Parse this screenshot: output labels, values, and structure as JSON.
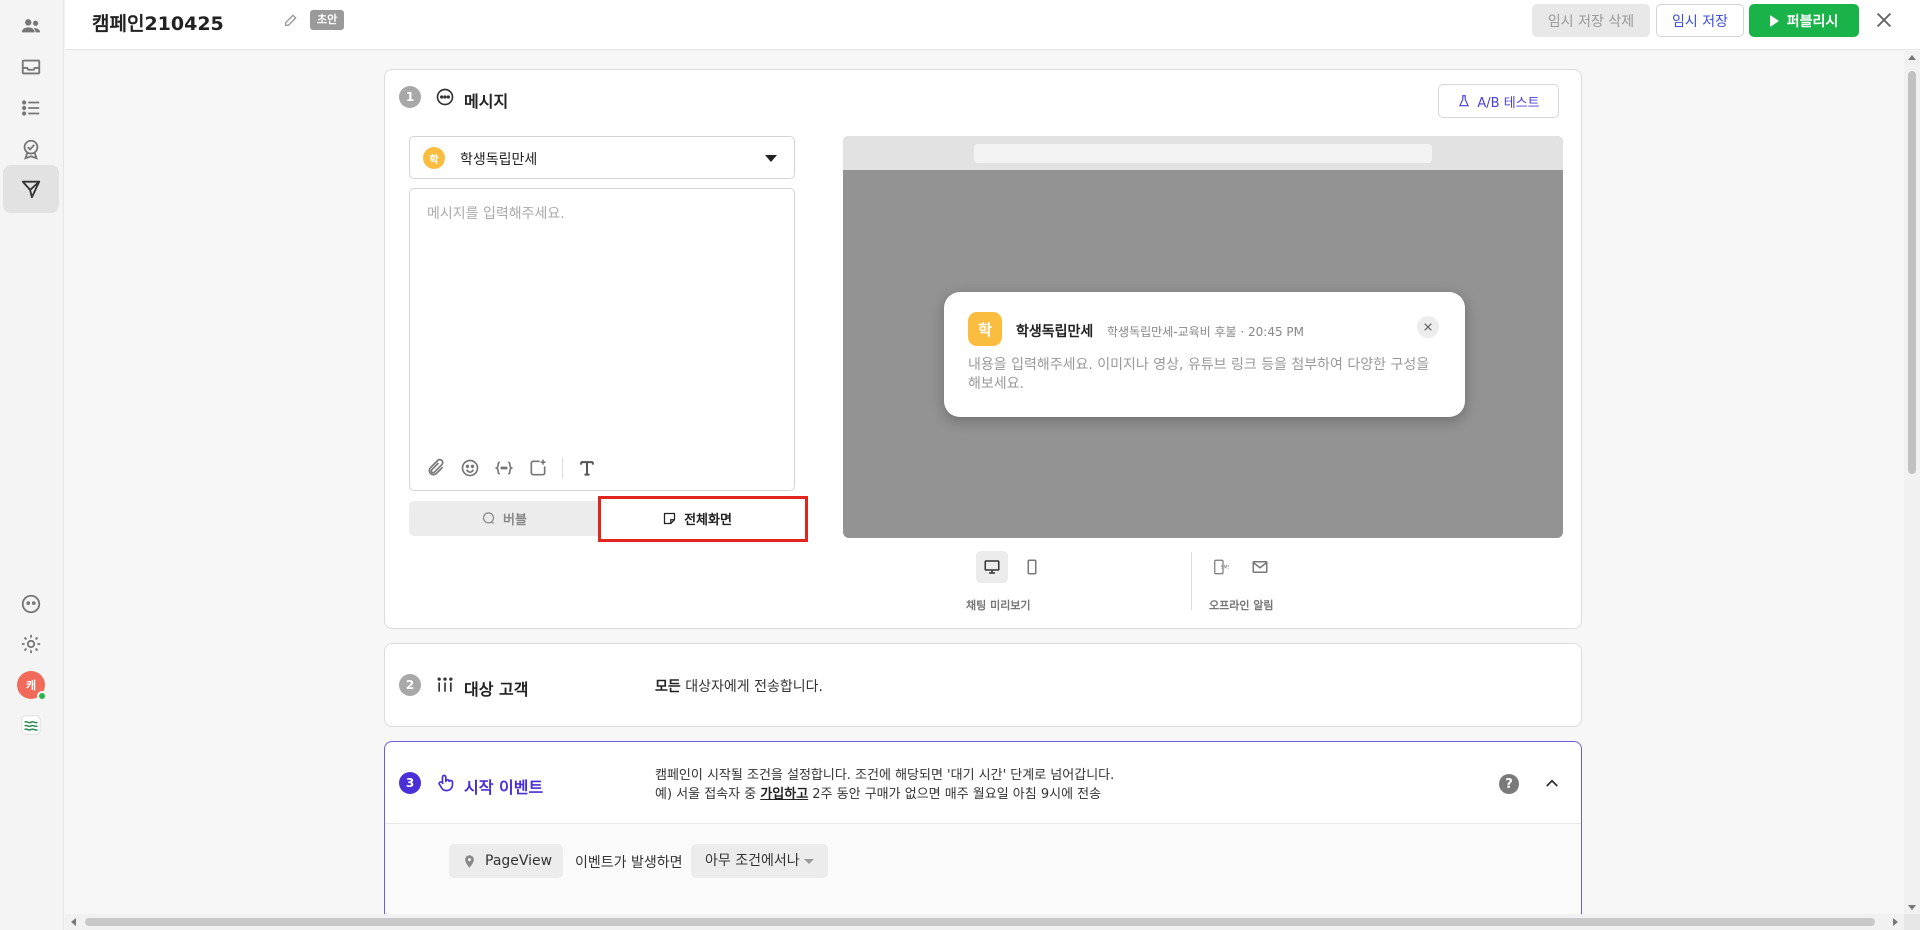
{
  "topbar": {
    "title": "캠페인210425",
    "status_badge": "초안",
    "delete_draft_label": "임시 저장 삭제",
    "save_draft_label": "임시 저장",
    "publish_label": "퍼블리시"
  },
  "sidebar": {
    "avatar_initial": "캐",
    "items": [
      "people-icon",
      "inbox-icon",
      "list-icon",
      "badge-check-icon",
      "send-icon",
      "face-icon",
      "gear-icon",
      "avatar",
      "brand-logo-icon"
    ]
  },
  "message_section": {
    "step": "1",
    "title": "메시지",
    "ab_test_label": "A/B 테스트",
    "sender_avatar": "학",
    "sender_name": "학생독립만세",
    "message_placeholder": "메시지를 입력해주세요.",
    "toolbar_icons": [
      "attach-icon",
      "emoji-icon",
      "variable-icon",
      "image-add-icon",
      "text-format-icon"
    ],
    "mode_bubble_label": "버블",
    "mode_fullscreen_label": "전체화면",
    "selected_mode": "전체화면",
    "preview": {
      "avatar": "학",
      "name": "학생독립만세",
      "meta": "학생독립만세-교육비 후불 · 20:45 PM",
      "body": "내용을 입력해주세요. 이미지나 영상, 유튜브 링크 등을 첨부하여 다양한 구성을 해보세요."
    },
    "device_labels": {
      "chat_preview": "채팅 미리보기",
      "offline_alert": "오프라인 알림"
    }
  },
  "target_section": {
    "step": "2",
    "title": "대상 고객",
    "desc_bold": "모든",
    "desc_rest": " 대상자에게 전송합니다."
  },
  "start_event_section": {
    "step": "3",
    "title": "시작 이벤트",
    "desc_line1": "캠페인이 시작될 조건을 설정합니다. 조건에 해당되면 '대기 시간' 단계로 넘어갑니다.",
    "desc_line2_pre": "예) 서울 접속자 중 ",
    "desc_line2_link": "가입하고",
    "desc_line2_post": " 2주 동안 구매가 없으면 매주 월요일 아침 9시에 전송",
    "help_label": "?",
    "event_chip": "PageView",
    "event_text": "이벤트가 발생하면",
    "condition_select": "아무 조건에서나"
  },
  "colors": {
    "accent_purple": "#4a2fd6",
    "publish_green": "#19b34a",
    "highlight_red": "#e2241f",
    "channel_yellow": "#fbbd3f"
  }
}
